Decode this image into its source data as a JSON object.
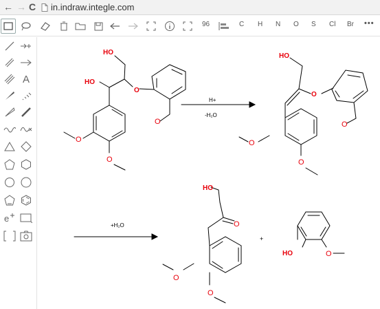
{
  "browser": {
    "url": "in.indraw.integle.com",
    "back_glyph": "←",
    "forward_glyph": "→",
    "reload_glyph": "C"
  },
  "toolbar": {
    "zoom_value": "96",
    "elements": [
      "C",
      "H",
      "N",
      "O",
      "S",
      "Cl",
      "Br"
    ],
    "more_glyph": "•••"
  },
  "palette": {
    "text_tool_glyph": "A",
    "text_tool_glyph_2": "A"
  },
  "reaction1": {
    "reactant_labels": {
      "oh_top": "HO",
      "oh_mid": "HO",
      "o_ether": "O",
      "ome_aryl": "O",
      "ome_ring1": "O",
      "ome_ring2": "O"
    },
    "reagent_top": "H+",
    "reagent_bottom": "-H₂O",
    "product_labels": {
      "oh_top": "HO",
      "o_ether": "O",
      "ome_aryl": "O",
      "ome_ring1": "O",
      "ome_ring2": "O"
    }
  },
  "reaction2": {
    "reagent_top": "+H₂O",
    "product_labels": {
      "oh_top": "HO",
      "ketone_o": "O",
      "ome_ring1": "O",
      "ome_ring2": "O"
    },
    "plus": "+",
    "guaiacol_labels": {
      "oh": "HO",
      "ome": "O"
    }
  },
  "colors": {
    "hetero": "#e8000b",
    "bond": "#000000",
    "icon": "#6f6f6f"
  }
}
